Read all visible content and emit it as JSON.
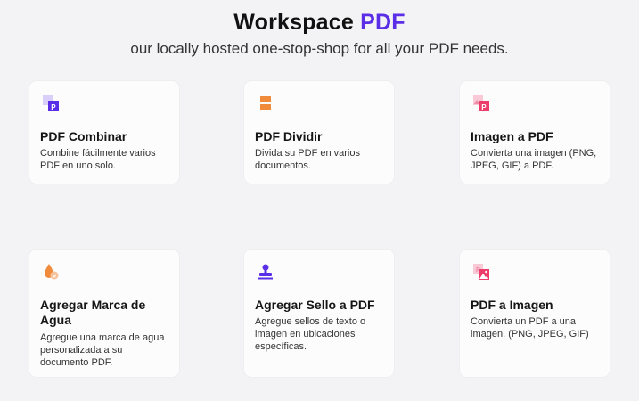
{
  "header": {
    "title_main": "Workspace ",
    "title_accent": "PDF",
    "subtitle": "our locally hosted one-stop-shop for all your PDF needs."
  },
  "colors": {
    "accent": "#5a2ee6",
    "orange": "#f08b3c",
    "pink": "#ec3d6b",
    "background": "#f3f3f5",
    "card": "#fcfcfd"
  },
  "tools": [
    {
      "title": "PDF Combinar",
      "description": "Combine fácilmente varios PDF en uno solo.",
      "icon": "merge-pdf-icon"
    },
    {
      "title": "PDF Dividir",
      "description": "Divida su PDF en varios documentos.",
      "icon": "split-pdf-icon"
    },
    {
      "title": "Imagen a PDF",
      "description": "Convierta una imagen (PNG, JPEG, GIF) a PDF.",
      "icon": "image-to-pdf-icon"
    },
    {
      "title": "Agregar Marca de Agua",
      "description": "Agregue una marca de agua personalizada a su documento PDF.",
      "icon": "watermark-icon"
    },
    {
      "title": "Agregar Sello a PDF",
      "description": "Agregue sellos de texto o imagen en ubicaciones específicas.",
      "icon": "stamp-icon"
    },
    {
      "title": "PDF a Imagen",
      "description": "Convierta un PDF a una imagen. (PNG, JPEG, GIF)",
      "icon": "pdf-to-image-icon"
    }
  ]
}
